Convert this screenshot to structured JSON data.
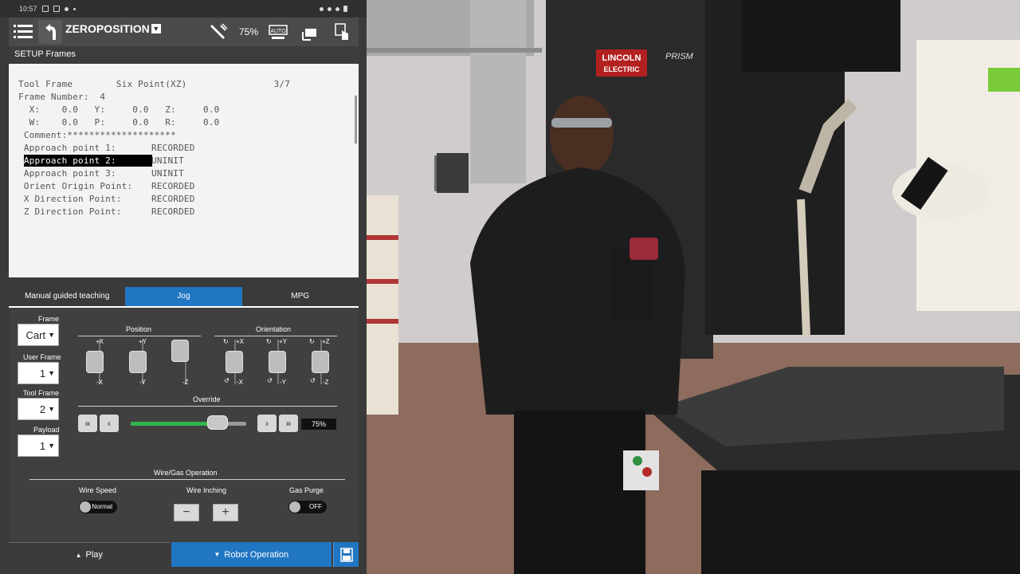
{
  "status_bar": {
    "time": "10:57"
  },
  "top_bar": {
    "program_name": "ZEROPOSITION",
    "program_caret": "▼",
    "speed": "75%",
    "auto_label": "AUTO"
  },
  "section_title": "SETUP Frames",
  "text_screen": {
    "line1": "Tool Frame        Six Point(XZ)                3/7",
    "line2": "Frame Number:  4",
    "line3": "  X:    0.0   Y:     0.0   Z:     0.0",
    "line4": "  W:    0.0   P:     0.0   R:     0.0",
    " line5": "",
    "comment": " Comment:********************",
    "rows": [
      {
        "label": " Approach point 1:",
        "value": "RECORDED"
      },
      {
        "label": " Approach point 2:",
        "value": "UNINIT"
      },
      {
        "label": " Approach point 3:",
        "value": "UNINIT"
      },
      {
        "label": " Orient Origin Point:",
        "value": "RECORDED"
      },
      {
        "label": " X Direction Point:",
        "value": "RECORDED"
      },
      {
        "label": " Z Direction Point:",
        "value": "RECORDED"
      }
    ]
  },
  "tabs": [
    {
      "label": "Manual guided teaching",
      "active": false
    },
    {
      "label": "Jog",
      "active": true
    },
    {
      "label": "MPG",
      "active": false
    }
  ],
  "jog": {
    "frame_label": "Frame",
    "frame_value": "Cart",
    "user_frame_label": "User Frame",
    "user_frame_value": "1",
    "tool_frame_label": "Tool Frame",
    "tool_frame_value": "2",
    "payload_label": "Payload",
    "payload_value": "1",
    "position_label": "Position",
    "orientation_label": "Orientation",
    "pos_axes": [
      {
        "plus": "+X",
        "minus": "-X"
      },
      {
        "plus": "+Y",
        "minus": "-Y"
      },
      {
        "plus": "+Z",
        "minus": "-Z"
      }
    ],
    "ori_axes": [
      {
        "plus": "+X",
        "minus": "-X"
      },
      {
        "plus": "+Y",
        "minus": "-Y"
      },
      {
        "plus": "+Z",
        "minus": "-Z"
      }
    ],
    "override_label": "Override",
    "override_value": "75%",
    "override_fraction": 0.75
  },
  "wire_gas": {
    "title": "Wire/Gas Operation",
    "wire_speed_label": "Wire Speed",
    "wire_speed_value": "Normal",
    "wire_inching_label": "Wire Inching",
    "minus": "−",
    "plus": "+",
    "gas_purge_label": "Gas Purge",
    "gas_purge_value": "OFF"
  },
  "bottom": {
    "play_label": "Play",
    "robot_op_label": "Robot Operation"
  },
  "photo": {
    "lincoln_top": "LINCOLN",
    "lincoln_bottom": "ELECTRIC",
    "prism": "PRISM"
  },
  "colors": {
    "accent_blue": "#2176c3",
    "override_green": "#2fb54a"
  }
}
